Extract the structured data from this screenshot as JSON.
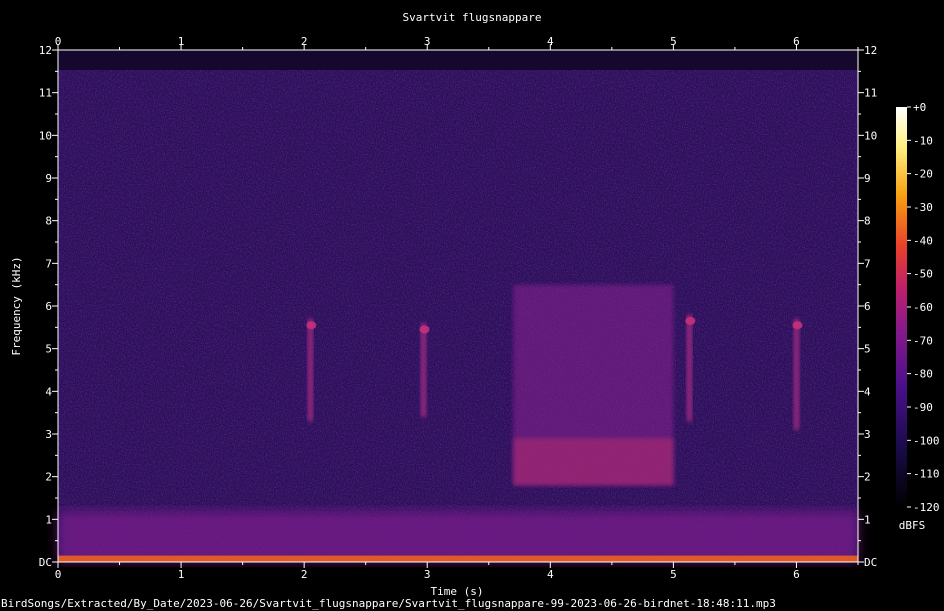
{
  "chart_data": {
    "type": "heatmap",
    "title": "Svartvit flugsnappare",
    "xlabel": "Time (s)",
    "ylabel": "Frequency (kHz)",
    "xlim": [
      0,
      6.5
    ],
    "ylim": [
      0,
      12
    ],
    "x_ticks": [
      "0",
      "1",
      "2",
      "3",
      "4",
      "5",
      "6"
    ],
    "y_ticks": [
      "DC",
      "1",
      "2",
      "3",
      "4",
      "5",
      "6",
      "7",
      "8",
      "9",
      "10",
      "11",
      "12"
    ],
    "colorbar": {
      "label": "dBFS",
      "range": [
        -120,
        0
      ],
      "ticks": [
        "+0",
        "-10",
        "-20",
        "-30",
        "-40",
        "-50",
        "-60",
        "-70",
        "-80",
        "-90",
        "-100",
        "-110",
        "-120"
      ],
      "colors": [
        "#000000",
        "#1a0b4a",
        "#4a0f8a",
        "#8a1a8a",
        "#c0206a",
        "#e8402a",
        "#f8a010",
        "#fff080",
        "#ffffff"
      ]
    },
    "features": [
      {
        "kind": "call",
        "t": 2.05,
        "f_low": 3.3,
        "f_high": 5.7
      },
      {
        "kind": "call",
        "t": 2.97,
        "f_low": 3.4,
        "f_high": 5.6
      },
      {
        "kind": "call",
        "t": 5.13,
        "f_low": 3.3,
        "f_high": 5.8
      },
      {
        "kind": "call",
        "t": 6.0,
        "f_low": 3.1,
        "f_high": 5.7
      },
      {
        "kind": "noise_block",
        "t_start": 3.7,
        "t_end": 5.0,
        "f_low": 1.8,
        "f_high": 6.5
      },
      {
        "kind": "low_band",
        "t_start": 0,
        "t_end": 6.5,
        "f_low": 0,
        "f_high": 1.2
      }
    ]
  },
  "footer": {
    "path": "BirdSongs/Extracted/By_Date/2023-06-26/Svartvit_flugsnappare/Svartvit_flugsnappare-99-2023-06-26-birdnet-18:48:11.mp3"
  }
}
